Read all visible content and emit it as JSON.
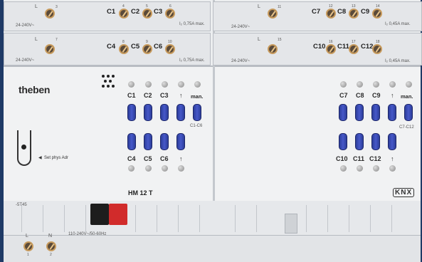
{
  "device": {
    "brand": "theben",
    "model": "HM 12 T",
    "standard": "KNX",
    "set_phys_adr": "Set phys Adr",
    "label_5745": "-5T45",
    "supply_rating": "110-240V~/50-60Hz",
    "supply_terminals": [
      {
        "letter": "L",
        "num": "1"
      },
      {
        "letter": "N",
        "num": "2"
      }
    ]
  },
  "top_terminals": {
    "row1_left": {
      "l": "L",
      "lnum": "3",
      "voltage": "24-240V~",
      "channels": [
        "C1",
        "C2",
        "C3"
      ],
      "nums": [
        "4",
        "5",
        "6"
      ],
      "rating": "I₂ 0,75A max."
    },
    "row2_left": {
      "l": "L",
      "lnum": "7",
      "voltage": "24-240V~",
      "channels": [
        "C4",
        "C5",
        "C6"
      ],
      "nums": [
        "8",
        "9",
        "10"
      ],
      "rating": "I₂ 0,75A max."
    },
    "row1_right": {
      "l": "L",
      "lnum": "11",
      "voltage": "24-240V~",
      "channels": [
        "C7",
        "C8",
        "C9"
      ],
      "nums": [
        "12",
        "13",
        "14"
      ],
      "rating": "I₂ 0,45A max."
    },
    "row2_right": {
      "l": "L",
      "lnum": "15",
      "voltage": "24-240V~",
      "channels": [
        "C10",
        "C11",
        "C12"
      ],
      "nums": [
        "16",
        "17",
        "18"
      ],
      "rating": "I₂ 0,45A max."
    }
  },
  "panel": {
    "left_top_labels": [
      "C1",
      "C2",
      "C3",
      "↑",
      "man."
    ],
    "left_group_label": "C1-C6",
    "left_bottom_labels": [
      "C4",
      "C5",
      "C6",
      "↑"
    ],
    "right_top_labels": [
      "C7",
      "C8",
      "C9",
      "↑",
      "man."
    ],
    "right_group_label": "C7-C12",
    "right_bottom_labels": [
      "C10",
      "C11",
      "C12",
      "↑"
    ]
  },
  "colors": {
    "background": "#1f3a66",
    "button": "#3a4cb4",
    "terminal_lug": "#c79a5c",
    "connector_red": "#d12b2b"
  }
}
